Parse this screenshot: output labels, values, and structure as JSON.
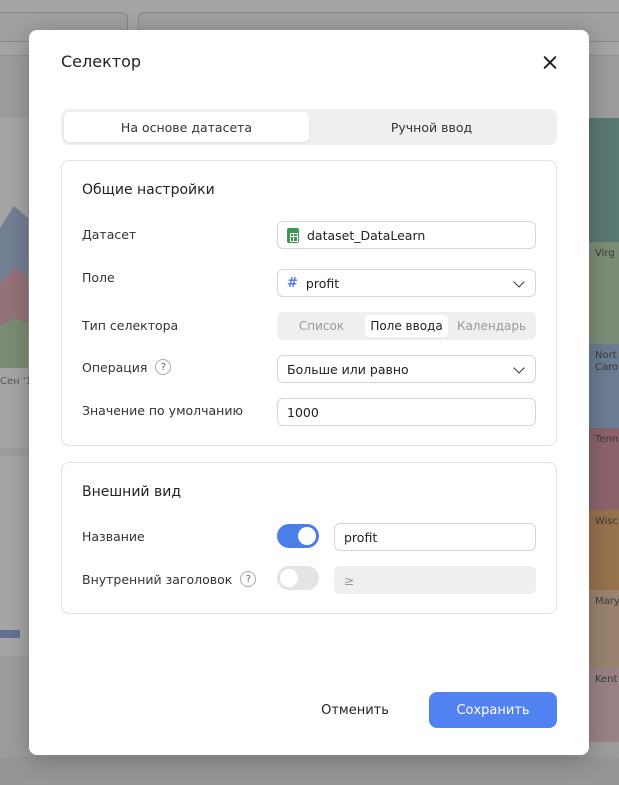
{
  "background": {
    "axis_label": "Сен '1",
    "treemap_tiles": [
      "Virg",
      "Nort Caro",
      "Tenn",
      "Wisc",
      "Mary",
      "Kent"
    ]
  },
  "dialog": {
    "title": "Селектор",
    "source_tabs": [
      "На основе датасета",
      "Ручной ввод"
    ],
    "active_source_tab": "На основе датасета",
    "general": {
      "title": "Общие настройки",
      "dataset_label": "Датасет",
      "dataset_value": "dataset_DataLearn",
      "field_label": "Поле",
      "field_value": "profit",
      "selector_type_label": "Тип селектора",
      "selector_types": [
        "Список",
        "Поле ввода",
        "Календарь"
      ],
      "selector_type_active": "Поле ввода",
      "operation_label": "Операция",
      "operation_value": "Больше или равно",
      "default_value_label": "Значение по умолчанию",
      "default_value": "1000",
      "help_glyph": "?"
    },
    "appearance": {
      "title": "Внешний вид",
      "name_label": "Название",
      "name_toggle_on": true,
      "name_value": "profit",
      "inner_title_label": "Внутренний заголовок",
      "inner_title_toggle_on": false,
      "inner_title_value": "≥",
      "help_glyph": "?"
    },
    "buttons": {
      "cancel": "Отменить",
      "save": "Сохранить"
    }
  },
  "colors": {
    "accent": "#5282f1",
    "toggle_on": "#4c7de8",
    "dataset_icon": "#3a9b4f"
  },
  "icons": {
    "close": "close-icon",
    "dataset": "spreadsheet-icon",
    "field": "hash-icon",
    "dropdown": "chevron-down-icon",
    "help": "question-icon"
  }
}
